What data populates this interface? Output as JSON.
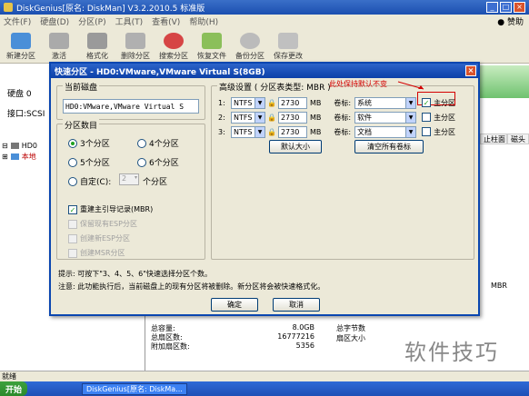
{
  "app": {
    "title": "DiskGenius[原名: DiskMan] V3.2.2010.5 标准版",
    "menu": [
      "文件(F)",
      "硬盘(D)",
      "分区(P)",
      "工具(T)",
      "查看(V)",
      "帮助(H)"
    ],
    "help": "赞助",
    "toolbar": [
      "新建分区",
      "激活",
      "格式化",
      "删除分区",
      "搜索分区",
      "恢复文件",
      "备份分区",
      "保存更改"
    ]
  },
  "left_panel": {
    "disk_label": "硬盘 0",
    "interface_label": "接口:SCSI",
    "tree_root": "HD0",
    "tree_child": "本地"
  },
  "columns": [
    "止柱面",
    "磁头"
  ],
  "mbr_label": "MBR",
  "stats": {
    "rows": [
      {
        "k": "总容量:",
        "v": "8.0GB"
      },
      {
        "k": "总扇区数:",
        "v": "16777216"
      },
      {
        "k": "附加扇区数:",
        "v": "5356"
      }
    ],
    "right": [
      "总字节数",
      "扇区大小"
    ]
  },
  "status": "就绪",
  "taskbar": {
    "start": "开始",
    "item": "DiskGenius[原名: DiskMa..."
  },
  "watermark": "软件技巧",
  "dialog": {
    "title": "快速分区 - HD0:VMware,VMware Virtual S(8GB)",
    "current_disk_label": "当前磁盘",
    "current_disk_value": "HD0:VMware,VMware Virtual S",
    "partition_count_label": "分区数目",
    "radios": [
      {
        "label": "3个分区",
        "selected": true
      },
      {
        "label": "4个分区",
        "selected": false
      },
      {
        "label": "5个分区",
        "selected": false
      },
      {
        "label": "6个分区",
        "selected": false
      },
      {
        "label": "自定(C):",
        "selected": false
      }
    ],
    "custom_value": "2",
    "custom_suffix": "个分区",
    "checks": [
      {
        "label": "重建主引导记录(MBR)",
        "checked": true,
        "disabled": false
      },
      {
        "label": "保留现有ESP分区",
        "checked": false,
        "disabled": true
      },
      {
        "label": "创建新ESP分区",
        "checked": false,
        "disabled": true
      },
      {
        "label": "创建MSR分区",
        "checked": false,
        "disabled": true
      }
    ],
    "advanced_label": "高级设置 ( 分区表类型: MBR )",
    "red_note": "此处保持默认不变",
    "partitions": [
      {
        "index": "1:",
        "fs": "NTFS",
        "size": "2730",
        "unit": "MB",
        "vol_label": "卷标:",
        "vol": "系统",
        "primary": true,
        "primary_label": "主分区"
      },
      {
        "index": "2:",
        "fs": "NTFS",
        "size": "2730",
        "unit": "MB",
        "vol_label": "卷标:",
        "vol": "软件",
        "primary": false,
        "primary_label": "主分区"
      },
      {
        "index": "3:",
        "fs": "NTFS",
        "size": "2730",
        "unit": "MB",
        "vol_label": "卷标:",
        "vol": "文档",
        "primary": false,
        "primary_label": "主分区"
      }
    ],
    "default_size_btn": "默认大小",
    "clear_labels_btn": "清空所有卷标",
    "hint": "提示: 可按下\"3、4、5、6\"快速选择分区个数。",
    "notice": "注意: 此功能执行后，当前磁盘上的现有分区将被删除。新分区将会被快速格式化。",
    "ok": "确定",
    "cancel": "取消"
  },
  "colors": {
    "title_blue": "#0c40a8",
    "note_red": "#d40000"
  }
}
